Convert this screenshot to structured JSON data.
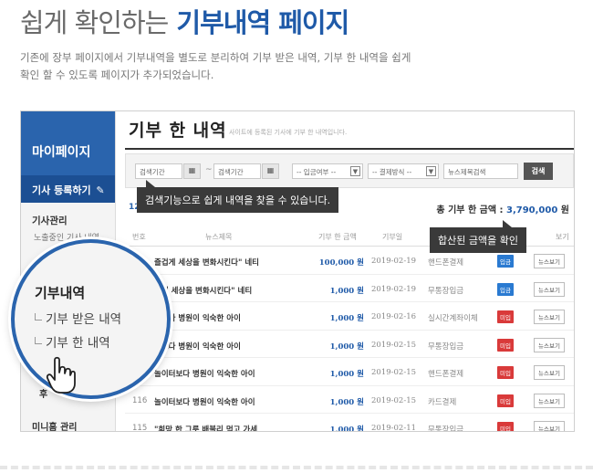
{
  "headline": {
    "light": "쉽게 확인하는",
    "strong": "기부내역 페이지"
  },
  "description": [
    "기존에 장부 페이지에서 기부내역을 별도로 분리하여 기부 받은 내역, 기부 한 내역을 쉽게",
    "확인 할 수 있도록 페이지가 추가되었습니다."
  ],
  "sidebar": {
    "header": "마이페이지",
    "register_prefix": "기사",
    "register_label": "등록하기",
    "section1_title": "기사관리",
    "section1_sub": "노출중인 기사 내역",
    "wu_label": "후",
    "bottom_title": "미니홈 관리"
  },
  "magnifier": {
    "title": "기부내역",
    "items": [
      "기부 받은 내역",
      "기부 한 내역"
    ],
    "extra": "역"
  },
  "content": {
    "title": "기부 한 내역",
    "subtitle": "사이트에 등록된 기사에 기부 한 내역입니다."
  },
  "search": {
    "date_start": "검색기간",
    "tilde": "~",
    "date_end": "검색기간",
    "deposit_select": "-- 입금여부 --",
    "method_select": "-- 결제방식 --",
    "keyword_placeholder": "뉴스제목검색",
    "button": "검색"
  },
  "summary": {
    "count": "12",
    "total_label": "총 기부 한 금액 :",
    "total_value": "3,790,000",
    "total_unit": "원"
  },
  "tooltips": {
    "search": "검색기능으로 쉽게 내역을 찾을 수 있습니다.",
    "total": "합산된 금액을 확인"
  },
  "table": {
    "headers": [
      "번호",
      "뉴스제목",
      "기부 한 금액",
      "기부일",
      "보기"
    ],
    "rows": [
      {
        "no": "",
        "title": "즐겁게 세상을 변화시킨다\" 네티",
        "amount": "100,000 원",
        "date": "2019-02-19",
        "pay": "핸드폰결제",
        "status": "입금",
        "status_type": "in",
        "view": "뉴스보기"
      },
      {
        "no": "",
        "title": "겁게 세상을 변화시킨다\" 네티",
        "amount": "1,000 원",
        "date": "2019-02-19",
        "pay": "무통장입금",
        "status": "입금",
        "status_type": "in",
        "view": "뉴스보기"
      },
      {
        "no": "",
        "title": "터보다 병원이 익숙한 아이",
        "amount": "1,000 원",
        "date": "2019-02-16",
        "pay": "실시간계좌이체",
        "status": "미입",
        "status_type": "miss",
        "view": "뉴스보기"
      },
      {
        "no": "",
        "title": "터보다 병원이 익숙한 아이",
        "amount": "1,000 원",
        "date": "2019-02-15",
        "pay": "무통장입금",
        "status": "미입",
        "status_type": "miss",
        "view": "뉴스보기"
      },
      {
        "no": "",
        "title": "놀이터보다 병원이 익숙한 아이",
        "amount": "1,000 원",
        "date": "2019-02-15",
        "pay": "핸드폰결제",
        "status": "미입",
        "status_type": "miss",
        "view": "뉴스보기"
      },
      {
        "no": "116",
        "title": "놀이터보다 병원이 익숙한 아이",
        "amount": "1,000 원",
        "date": "2019-02-15",
        "pay": "카드결제",
        "status": "미입",
        "status_type": "miss",
        "view": "뉴스보기"
      },
      {
        "no": "115",
        "title": "\"희망 한 그릇 배불리 먹고 가세",
        "amount": "1,000 원",
        "date": "2019-02-11",
        "pay": "무통장입금",
        "status": "미입",
        "status_type": "miss",
        "view": "뉴스보기"
      }
    ]
  }
}
